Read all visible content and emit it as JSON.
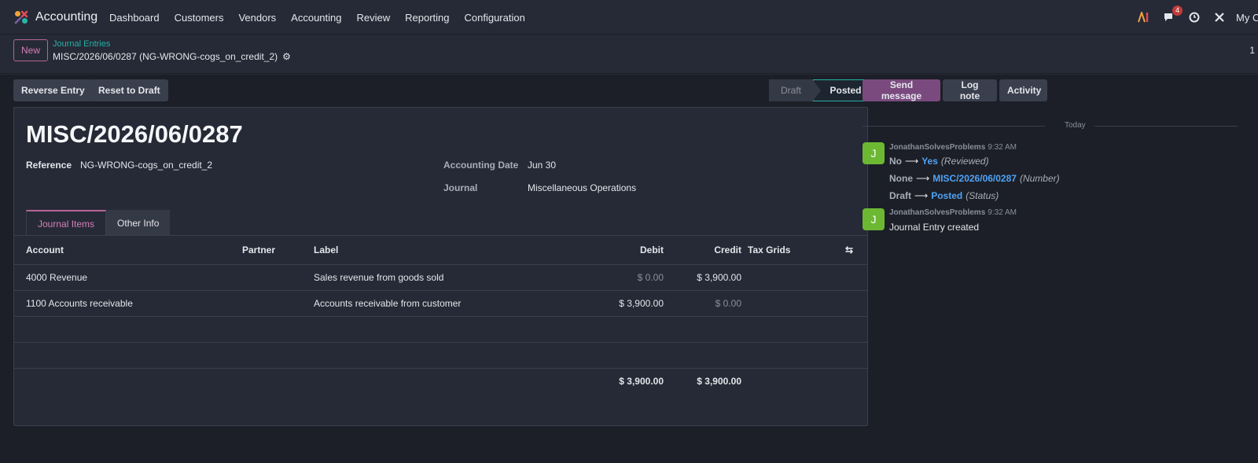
{
  "navbar": {
    "app_name": "Accounting",
    "menu": [
      "Dashboard",
      "Customers",
      "Vendors",
      "Accounting",
      "Review",
      "Reporting",
      "Configuration"
    ],
    "messages_badge": "4",
    "company": "My C"
  },
  "control_panel": {
    "new_label": "New",
    "breadcrumb_parent": "Journal Entries",
    "breadcrumb_current": "MISC/2026/06/0287 (NG-WRONG-cogs_on_credit_2)",
    "pager": "1"
  },
  "actions": {
    "reverse_entry": "Reverse Entry",
    "reset_to_draft": "Reset to Draft"
  },
  "statusbar": {
    "draft": "Draft",
    "posted": "Posted"
  },
  "form": {
    "title": "MISC/2026/06/0287",
    "reference_label": "Reference",
    "reference_value": "NG-WRONG-cogs_on_credit_2",
    "accounting_date_label": "Accounting Date",
    "accounting_date_value": "Jun 30",
    "journal_label": "Journal",
    "journal_value": "Miscellaneous Operations"
  },
  "tabs": {
    "journal_items": "Journal Items",
    "other_info": "Other Info"
  },
  "lines": {
    "headers": {
      "account": "Account",
      "partner": "Partner",
      "label": "Label",
      "debit": "Debit",
      "credit": "Credit",
      "tax_grids": "Tax Grids"
    },
    "rows": [
      {
        "account": "4000 Revenue",
        "partner": "",
        "label": "Sales revenue from goods sold",
        "debit": "$ 0.00",
        "credit": "$ 3,900.00"
      },
      {
        "account": "1100 Accounts receivable",
        "partner": "",
        "label": "Accounts receivable from customer",
        "debit": "$ 3,900.00",
        "credit": "$ 0.00"
      }
    ],
    "total_debit": "$ 3,900.00",
    "total_credit": "$ 3,900.00"
  },
  "chatter": {
    "send_message": "Send message",
    "log_note": "Log note",
    "activity": "Activity",
    "divider": "Today",
    "messages": [
      {
        "avatar": "J",
        "author": "JonathanSolvesProblems",
        "time": "9:32 AM",
        "tracking": [
          {
            "old": "No",
            "new": "Yes",
            "field": "(Reviewed)"
          },
          {
            "old": "None",
            "new": "MISC/2026/06/0287",
            "field": "(Number)"
          },
          {
            "old": "Draft",
            "new": "Posted",
            "field": "(Status)"
          }
        ]
      },
      {
        "avatar": "J",
        "author": "JonathanSolvesProblems",
        "time": "9:32 AM",
        "body": "Journal Entry created"
      }
    ]
  },
  "colors": {
    "accent": "#b66597",
    "teal": "#25b1a7",
    "link_blue": "#4fa3f7",
    "avatar_green": "#6cb833"
  }
}
